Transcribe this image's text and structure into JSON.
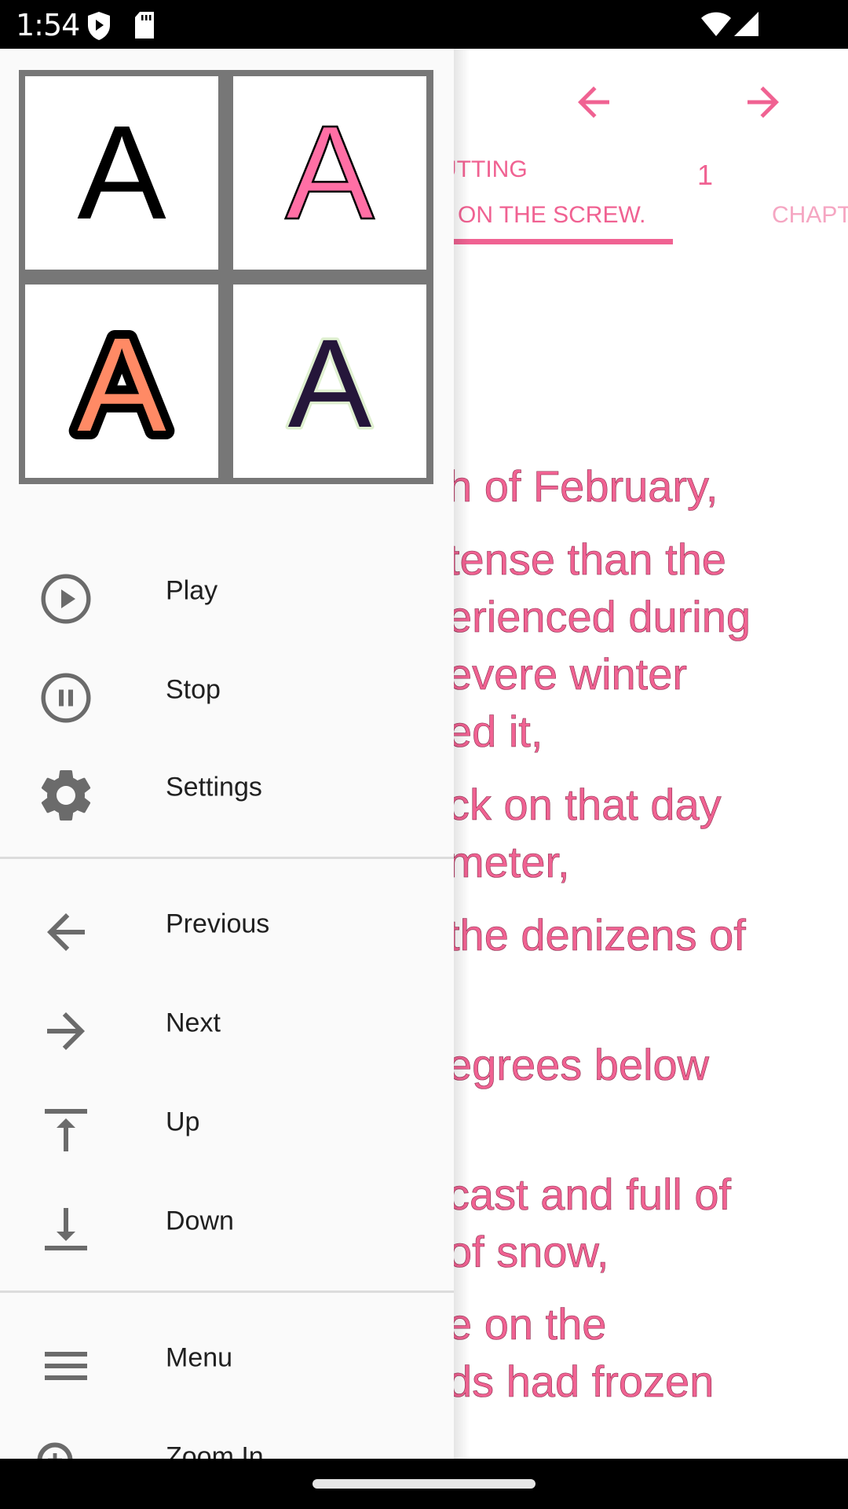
{
  "status_bar": {
    "time": "1:54",
    "left_icons": [
      "shield-play-icon",
      "sd-card-icon"
    ],
    "right_icons": [
      "wifi-icon",
      "signal-icon"
    ]
  },
  "reader": {
    "accent_color": "#f06292",
    "prev_chapter_icon": "arrow-left-icon",
    "next_chapter_icon": "arrow-right-icon",
    "tabs": [
      {
        "label_line1": "PUTTING",
        "label_line2": "SCREW",
        "label_visible": "ON THE SCREW.",
        "selected": true
      },
      {
        "label_visible": "CHAPT",
        "selected": false
      }
    ],
    "page_number": "1",
    "text_lines": [
      "h of February,",
      "tense than the",
      "erienced during",
      "evere winter",
      "ed it,",
      "ck on that day",
      "meter,",
      "the denizens of",
      "egrees below",
      "cast and full of",
      "of snow,",
      "e on the",
      "ds had frozen"
    ]
  },
  "drawer": {
    "font_styles": [
      {
        "name": "plain",
        "glyph": "A",
        "fill": "#000000"
      },
      {
        "name": "outlined-pink",
        "glyph": "A",
        "fill": "#ff6fa5",
        "stroke": "#000000"
      },
      {
        "name": "thick-outline-orange",
        "glyph": "A",
        "fill": "#ff8a65",
        "stroke": "#000000"
      },
      {
        "name": "glow-dark",
        "glyph": "A",
        "fill": "#25163a",
        "stroke": "#dff0d0"
      }
    ],
    "groups": [
      [
        {
          "id": "play",
          "label": "Play",
          "icon": "play-circle-icon"
        },
        {
          "id": "stop",
          "label": "Stop",
          "icon": "pause-circle-icon"
        },
        {
          "id": "settings",
          "label": "Settings",
          "icon": "gear-icon"
        }
      ],
      [
        {
          "id": "previous",
          "label": "Previous",
          "icon": "arrow-left-icon"
        },
        {
          "id": "next",
          "label": "Next",
          "icon": "arrow-right-icon"
        },
        {
          "id": "up",
          "label": "Up",
          "icon": "arrow-up-to-line-icon"
        },
        {
          "id": "down",
          "label": "Down",
          "icon": "arrow-down-to-line-icon"
        }
      ],
      [
        {
          "id": "menu",
          "label": "Menu",
          "icon": "hamburger-menu-icon"
        },
        {
          "id": "zoom-in",
          "label": "Zoom In",
          "icon": "zoom-in-icon"
        }
      ]
    ]
  }
}
